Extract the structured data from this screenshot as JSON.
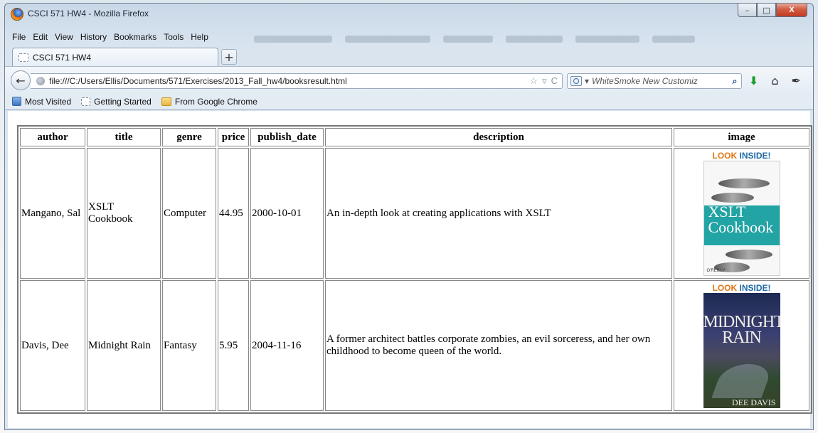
{
  "window": {
    "title": "CSCI 571 HW4 - Mozilla Firefox",
    "min_glyph": "–",
    "max_glyph": "□",
    "close_glyph": "X"
  },
  "menu": [
    "File",
    "Edit",
    "View",
    "History",
    "Bookmarks",
    "Tools",
    "Help"
  ],
  "tab": {
    "label": "CSCI 571 HW4",
    "new_tab_glyph": "+"
  },
  "navigation": {
    "back_glyph": "←",
    "url": "file:///C:/Users/Ellis/Documents/571/Exercises/2013_Fall_hw4/booksresult.html",
    "star_glyph": "☆",
    "dropdown_glyph": "▿",
    "reload_glyph": "C",
    "search_placeholder": "WhiteSmoke New Customiz",
    "search_dropdown_glyph": "▾",
    "search_go_glyph": "⌕",
    "download_glyph": "⬇",
    "home_glyph": "⌂",
    "addon_glyph": "✒"
  },
  "bookmarks": [
    "Most Visited",
    "Getting Started",
    "From Google Chrome"
  ],
  "table": {
    "headers": [
      "author",
      "title",
      "genre",
      "price",
      "publish_date",
      "description",
      "image"
    ],
    "rows": [
      {
        "author": "Mangano, Sal",
        "title": "XSLT Cookbook",
        "genre": "Computer",
        "price": "44.95",
        "publish_date": "2000-10-01",
        "description": "An in-depth look at creating applications with XSLT",
        "cover": {
          "badge_look": "LOOK",
          "badge_inside": "INSIDE!",
          "title": "XSLT Cookbook",
          "publisher": "O'REILLY"
        }
      },
      {
        "author": "Davis, Dee",
        "title": "Midnight Rain",
        "genre": "Fantasy",
        "price": "5.95",
        "publish_date": "2004-11-16",
        "description": "A former architect battles corporate zombies, an evil sorceress, and her own childhood to become queen of the world.",
        "cover": {
          "badge_look": "LOOK",
          "badge_inside": "INSIDE!",
          "title": "MIDNIGHT RAIN",
          "author": "DEE DAVIS"
        }
      }
    ]
  }
}
